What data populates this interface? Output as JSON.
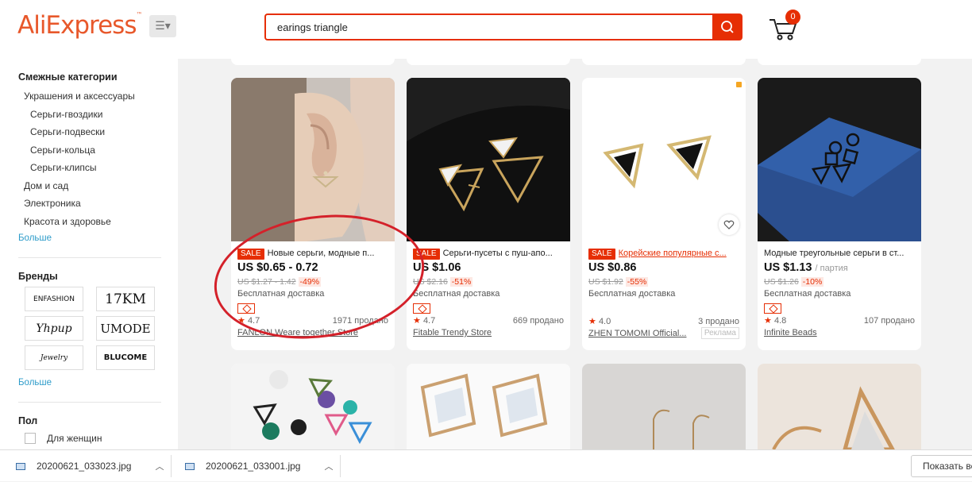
{
  "header": {
    "logo": "AliExpress",
    "search_value": "earings triangle",
    "cart_count": "0"
  },
  "sidebar": {
    "related_heading": "Смежные категории",
    "categories": [
      {
        "label": "Украшения и аксессуары",
        "level": 1
      },
      {
        "label": "Серьги-гвоздики",
        "level": 2
      },
      {
        "label": "Серьги-подвески",
        "level": 2
      },
      {
        "label": "Серьги-кольца",
        "level": 2
      },
      {
        "label": "Серьги-клипсы",
        "level": 2
      },
      {
        "label": "Дом и сад",
        "level": 1
      },
      {
        "label": "Электроника",
        "level": 1
      },
      {
        "label": "Красота и здоровье",
        "level": 1
      }
    ],
    "more_label": "Больше",
    "brands_heading": "Бренды",
    "brands": [
      "ENFASHION",
      "17KM",
      "Yhpup",
      "UMODE",
      "Jewelry",
      "BLUCOME"
    ],
    "brands_more": "Больше",
    "gender_heading": "Пол",
    "gender_option": "Для женщин"
  },
  "products": [
    {
      "sale": "SALE",
      "title": "Новые серьги, модные п...",
      "price": "US $0.65 - 0.72",
      "unit": "",
      "old_price": "US $1.27 - 1.42",
      "discount": "-49%",
      "shipping": "Бесплатная доставка",
      "rating": "4.7",
      "sold": "1971 продано",
      "store": "FANLON Weare together Store",
      "ad": ""
    },
    {
      "sale": "SALE",
      "title": "Серьги-пусеты с пуш-апо...",
      "price": "US $1.06",
      "unit": "",
      "old_price": "US $2.16",
      "discount": "-51%",
      "shipping": "Бесплатная доставка",
      "rating": "4.7",
      "sold": "669 продано",
      "store": "Fitable Trendy Store",
      "ad": ""
    },
    {
      "sale": "SALE",
      "title": "Корейские популярные с...",
      "price": "US $0.86",
      "unit": "",
      "old_price": "US $1.92",
      "discount": "-55%",
      "shipping": "Бесплатная доставка",
      "rating": "4.0",
      "sold": "3 продано",
      "store": "ZHEN TOMOMI Official...",
      "ad": "Реклама"
    },
    {
      "sale": "",
      "title": "Модные треугольные серьги в ст...",
      "price": "US $1.13",
      "unit": "/ партия",
      "old_price": "US $1.26",
      "discount": "-10%",
      "shipping": "Бесплатная доставка",
      "rating": "4.8",
      "sold": "107 продано",
      "store": "Infinite Beads",
      "ad": ""
    }
  ],
  "downloads": {
    "files": [
      "20200621_033023.jpg",
      "20200621_033001.jpg"
    ],
    "show_all": "Показать все"
  },
  "colors": {
    "accent": "#e62e04",
    "logo": "#e8582b",
    "link": "#2e9cca"
  }
}
